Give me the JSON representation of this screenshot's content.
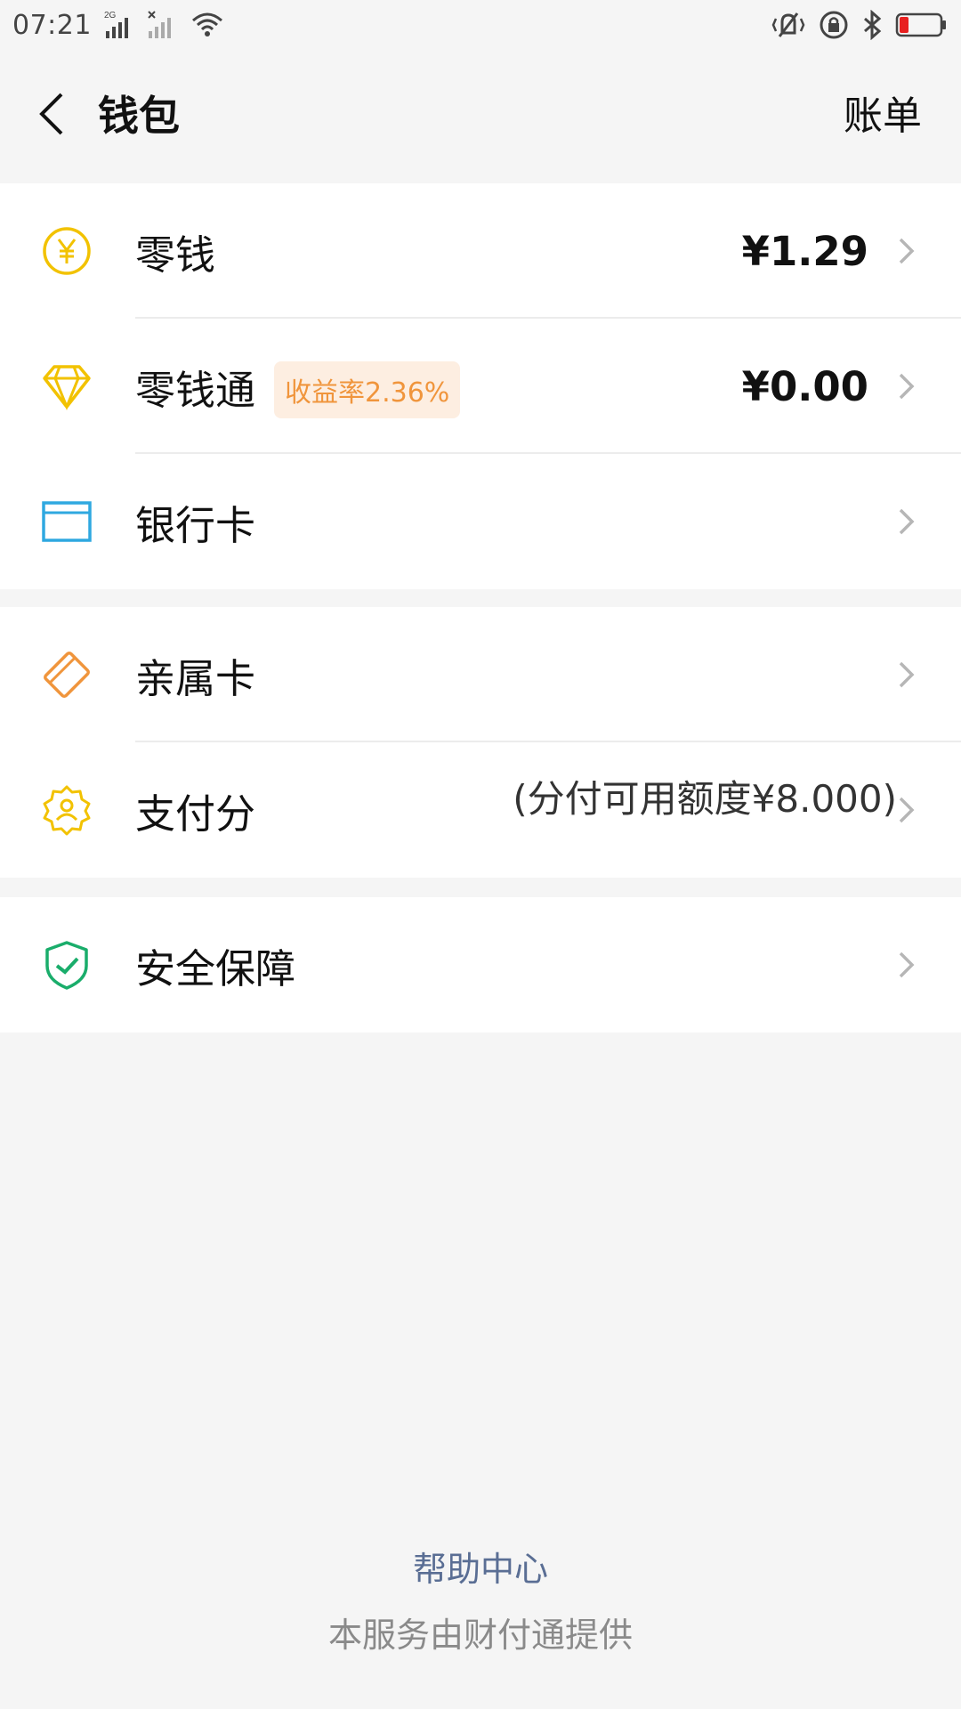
{
  "status_bar": {
    "time": "07:21",
    "network_label": "2G"
  },
  "header": {
    "title": "钱包",
    "right_action": "账单"
  },
  "sections": [
    {
      "items": [
        {
          "label": "零钱",
          "value": "¥1.29",
          "icon": "yuan-coin-icon"
        },
        {
          "label": "零钱通",
          "badge": "收益率2.36%",
          "value": "¥0.00",
          "icon": "diamond-icon"
        },
        {
          "label": "银行卡",
          "icon": "bank-card-icon"
        }
      ]
    },
    {
      "items": [
        {
          "label": "亲属卡",
          "icon": "family-card-icon"
        },
        {
          "label": "支付分",
          "value": "(分付可用额度¥8.000)",
          "icon": "pay-score-badge-icon"
        }
      ]
    },
    {
      "items": [
        {
          "label": "安全保障",
          "icon": "shield-check-icon"
        }
      ]
    }
  ],
  "footer": {
    "help_center": "帮助中心",
    "provider_note": "本服务由财付通提供"
  },
  "colors": {
    "background": "#f5f5f5",
    "yellow_icon": "#f2c200",
    "blue_icon": "#2fa8e0",
    "orange_icon": "#f0953c",
    "green_icon": "#1aad6b",
    "badge_bg": "#fdeee1",
    "link": "#5a6e94"
  }
}
